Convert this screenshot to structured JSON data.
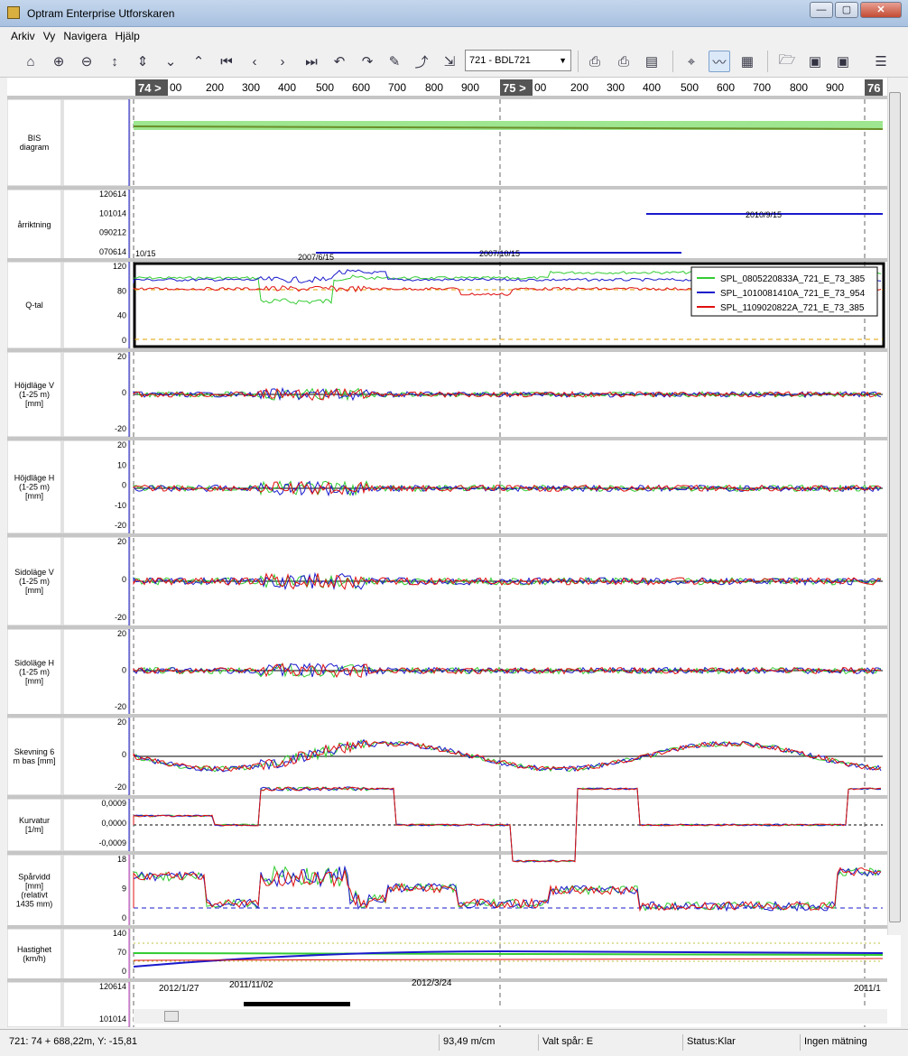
{
  "window": {
    "title": "Optram Enterprise Utforskaren",
    "min": "—",
    "max": "▢",
    "close": "✕"
  },
  "menu": [
    "Arkiv",
    "Vy",
    "Navigera",
    "Hjälp"
  ],
  "toolbar": {
    "route_selected": "721 - BDL721"
  },
  "ruler": {
    "km_markers": [
      "74 >",
      "75 >",
      "76"
    ],
    "ticks_km74": [
      "00",
      "200",
      "300",
      "400",
      "500",
      "600",
      "700",
      "800",
      "900"
    ],
    "ticks_km75": [
      "00",
      "200",
      "300",
      "400",
      "500",
      "600",
      "700",
      "800",
      "900"
    ]
  },
  "panels": [
    {
      "label": "BIS diagram",
      "ticks": []
    },
    {
      "label": "Spårriktning",
      "ticks": [
        "120614",
        "101014",
        "090212",
        "070614"
      ],
      "annotations": [
        "10/15",
        "2007/6/15",
        "2007/10/15",
        "2010/9/15"
      ]
    },
    {
      "label": "Q-tal",
      "ticks": [
        "120",
        "80",
        "40",
        "0"
      ]
    },
    {
      "label": "Höjdläge V (1-25 m) [mm]",
      "ticks": [
        "20",
        "0",
        "-20"
      ]
    },
    {
      "label": "Höjdläge H (1-25 m) [mm]",
      "ticks": [
        "20",
        "10",
        "0",
        "-10",
        "-20"
      ]
    },
    {
      "label": "Sidoläge V (1-25 m) [mm]",
      "ticks": [
        "20",
        "0",
        "-20"
      ]
    },
    {
      "label": "Sidoläge H (1-25 m) [mm]",
      "ticks": [
        "20",
        "0",
        "-20"
      ]
    },
    {
      "label": "Skevning 6 m bas [mm]",
      "ticks": [
        "20",
        "0",
        "-20"
      ]
    },
    {
      "label": "Kurvatur [1/m]",
      "ticks": [
        "0,0009",
        "0,0000",
        "-0,0009"
      ]
    },
    {
      "label": "Spårvidd [mm] (relativt 1435 mm)",
      "ticks": [
        "18",
        "9",
        "0"
      ]
    },
    {
      "label": "Hastighet (km/h)",
      "ticks": [
        "140",
        "70",
        "0"
      ]
    },
    {
      "label": "",
      "ticks": [
        "120614",
        "101014"
      ],
      "annotations": [
        "2012/1/27",
        "2011/11/02",
        "2012/3/24",
        "2011/1"
      ]
    }
  ],
  "legend": [
    {
      "name": "SPL_0805220833A_721_E_73_385",
      "color": "#33cc33"
    },
    {
      "name": "SPL_1010081410A_721_E_73_954",
      "color": "#1a1acc"
    },
    {
      "name": "SPL_1109020822A_721_E_73_385",
      "color": "#e01010"
    }
  ],
  "status": {
    "position": "721: 74 + 688,22m, Y: -15,81",
    "scale": "93,49 m/cm",
    "track": "Valt spår: E",
    "state": "Status:Klar",
    "measurement": "Ingen mätning"
  }
}
